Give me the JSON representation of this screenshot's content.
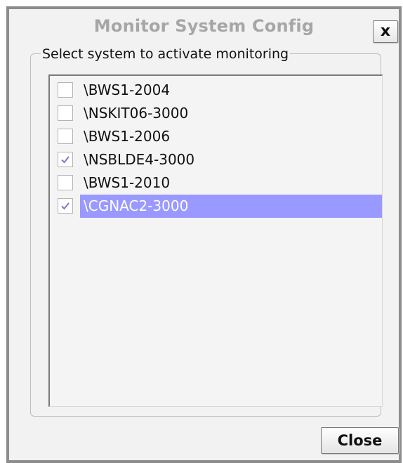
{
  "dialog": {
    "title": "Monitor System Config",
    "close_x_label": "x",
    "group_label": "Select system to activate monitoring",
    "close_button_label": "Close"
  },
  "systems": [
    {
      "name": "\\BWS1-2004",
      "checked": false,
      "selected": false
    },
    {
      "name": "\\NSKIT06-3000",
      "checked": false,
      "selected": false
    },
    {
      "name": "\\BWS1-2006",
      "checked": false,
      "selected": false
    },
    {
      "name": "\\NSBLDE4-3000",
      "checked": true,
      "selected": false
    },
    {
      "name": "\\BWS1-2010",
      "checked": false,
      "selected": false
    },
    {
      "name": "\\CGNAC2-3000",
      "checked": true,
      "selected": true
    }
  ],
  "colors": {
    "selection_bg": "#9999ff",
    "check_mark": "#7a7acc",
    "title_text": "#a6a6a6"
  },
  "icons": {
    "check": "check-icon"
  }
}
